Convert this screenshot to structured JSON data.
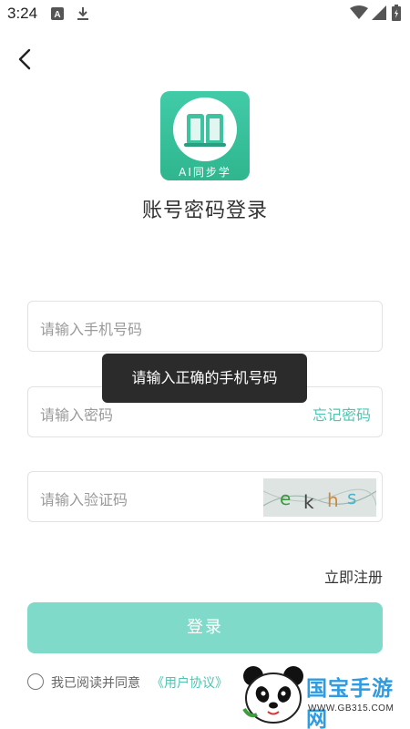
{
  "status_bar": {
    "time": "3:24",
    "icons": [
      "a-notification-icon",
      "download-icon",
      "wifi-icon",
      "signal-icon",
      "battery-icon"
    ]
  },
  "nav": {
    "back_icon": "chevron-left-icon"
  },
  "logo": {
    "caption": "AI同步学",
    "icon": "open-book-icon",
    "color": "#3dc3a0"
  },
  "page_title": "账号密码登录",
  "form": {
    "phone_placeholder": "请输入手机号码",
    "password_placeholder": "请输入密码",
    "forgot_password": "忘记密码",
    "captcha_placeholder": "请输入验证码",
    "captcha_text": "ekhs"
  },
  "toast": "请输入正确的手机号码",
  "register_label": "立即注册",
  "login_label": "登录",
  "agreement": {
    "text": "我已阅读并同意",
    "link": "《用户协议》"
  },
  "watermark": {
    "title": "国宝手游网",
    "url": "WWW.GB315.COM"
  },
  "colors": {
    "accent": "#4fc4b0",
    "login_button": "#7fdac9",
    "toast_bg": "#2b2b2b"
  }
}
